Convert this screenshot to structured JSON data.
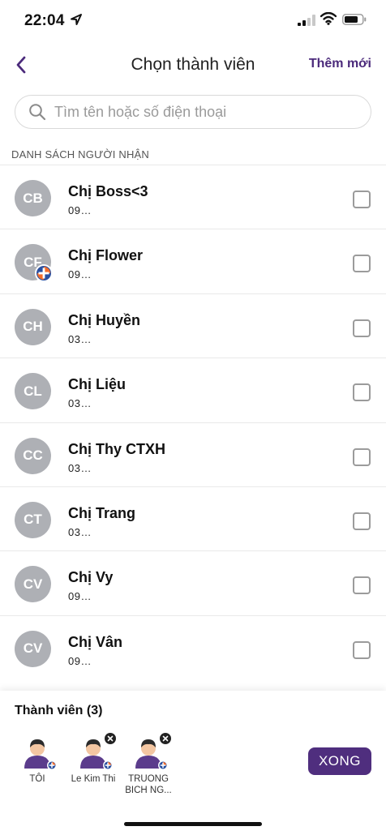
{
  "status_bar": {
    "time": "22:04"
  },
  "header": {
    "back_label": "",
    "title": "Chọn thành viên",
    "add_new": "Thêm mới"
  },
  "search": {
    "placeholder": "Tìm tên hoặc số điện thoại",
    "value": ""
  },
  "section_label": "DANH SÁCH NGƯỜI NHẬN",
  "contacts": [
    {
      "initials": "CB",
      "name": "Chị Boss<3",
      "phone": "09…",
      "checked": false,
      "badge": false
    },
    {
      "initials": "CF",
      "name": "Chị Flower",
      "phone": "09…",
      "checked": false,
      "badge": true
    },
    {
      "initials": "CH",
      "name": "Chị Huyền",
      "phone": "03…",
      "checked": false,
      "badge": false
    },
    {
      "initials": "CL",
      "name": "Chị Liệu",
      "phone": "03…",
      "checked": false,
      "badge": false
    },
    {
      "initials": "CC",
      "name": "Chị Thy CTXH",
      "phone": "03…",
      "checked": false,
      "badge": false
    },
    {
      "initials": "CT",
      "name": "Chị Trang",
      "phone": "03…",
      "checked": false,
      "badge": false
    },
    {
      "initials": "CV",
      "name": "Chị Vy",
      "phone": "09…",
      "checked": false,
      "badge": false
    },
    {
      "initials": "CV",
      "name": "Chị Vân",
      "phone": "09…",
      "checked": false,
      "badge": false
    }
  ],
  "members_panel": {
    "title": "Thành viên (3)",
    "members": [
      {
        "label": "TÔI",
        "removable": false
      },
      {
        "label": "Le Kim Thi",
        "removable": true
      },
      {
        "label": "TRUONG BICH NG...",
        "removable": true
      }
    ],
    "done_label": "XONG"
  },
  "colors": {
    "accent": "#4f2e7e",
    "avatar_gray": "#aeb0b5",
    "avatar_person": "#5b3c8c",
    "skin": "#f3c6a2",
    "hair": "#2b2b2b",
    "badge_orange": "#f26b2a",
    "badge_blue": "#2a4f9f"
  }
}
